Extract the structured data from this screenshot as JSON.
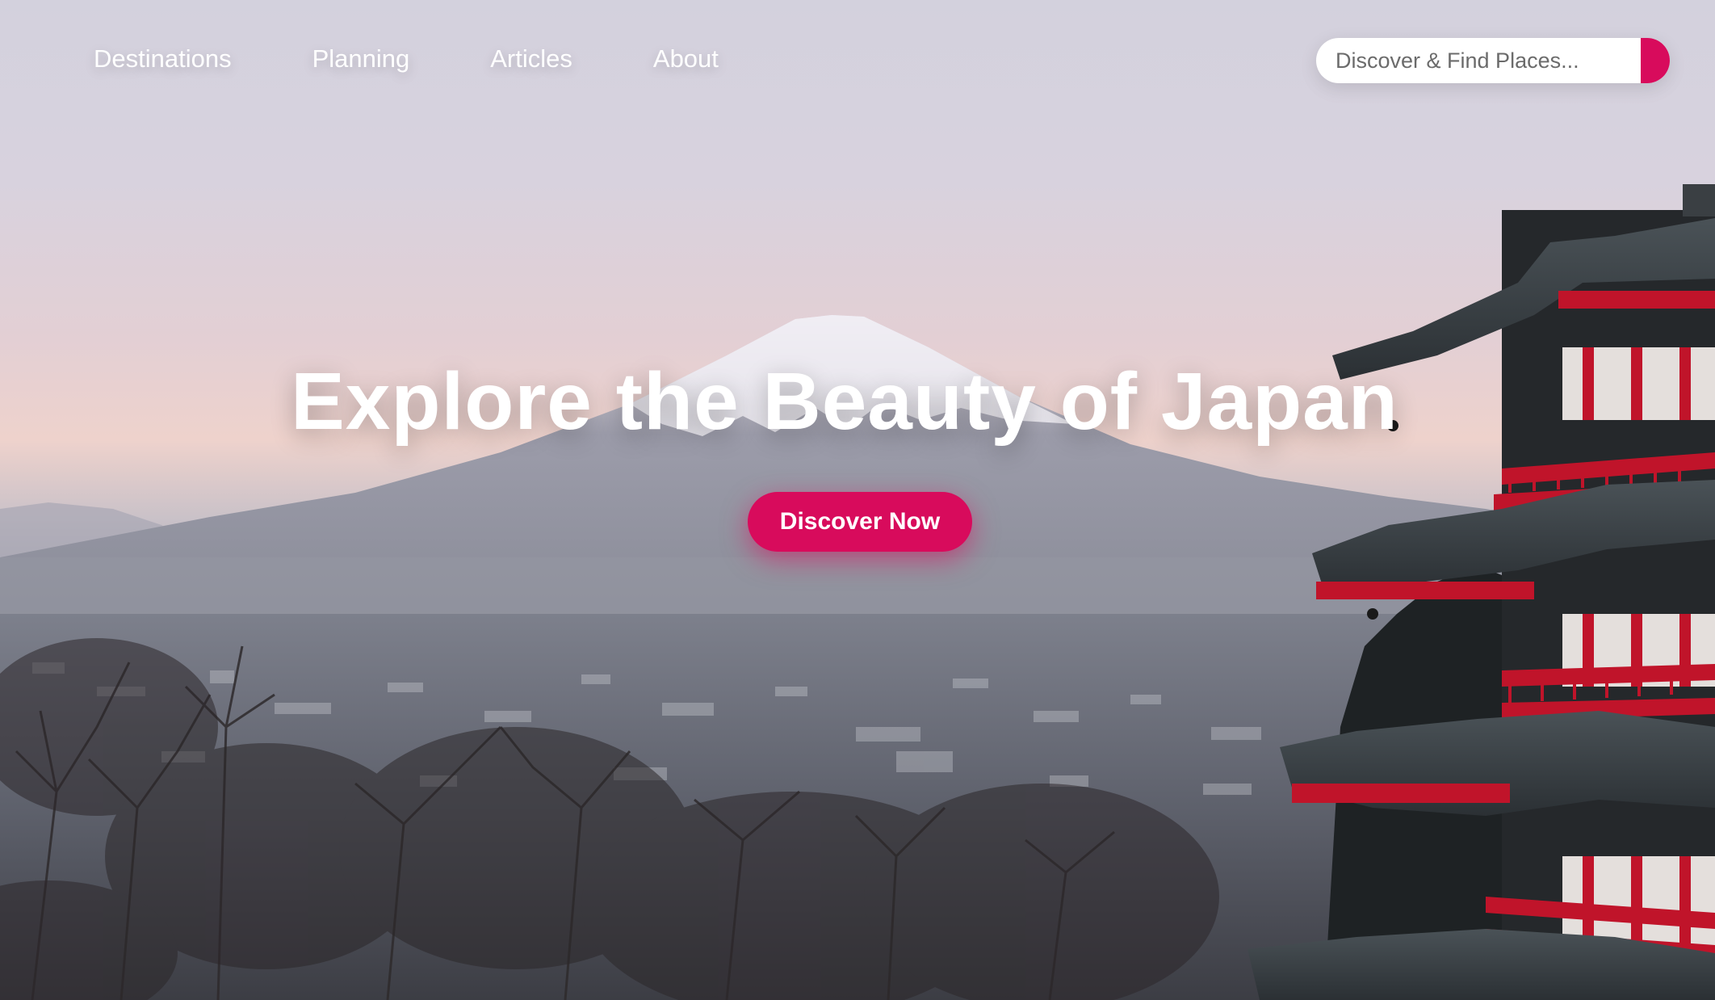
{
  "nav": {
    "items": [
      {
        "label": "Destinations"
      },
      {
        "label": "Planning"
      },
      {
        "label": "Articles"
      },
      {
        "label": "About"
      }
    ]
  },
  "search": {
    "placeholder": "Discover & Find Places...",
    "button_icon": "search-icon"
  },
  "hero": {
    "title": "Explore the Beauty of Japan",
    "cta_label": "Discover Now"
  },
  "colors": {
    "accent": "#d80b5c",
    "text_light": "#ffffff",
    "pagoda_red": "#c0142a"
  }
}
